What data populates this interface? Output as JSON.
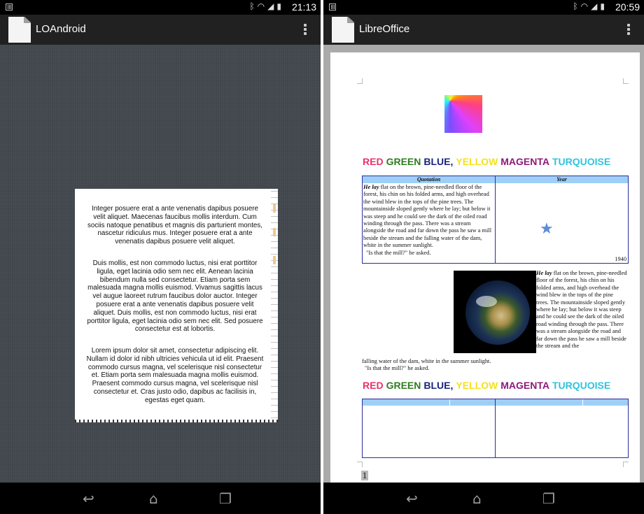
{
  "left_screen": {
    "status": {
      "time": "21:13"
    },
    "appbar": {
      "title": "LOAndroid"
    },
    "document": {
      "paragraphs": [
        "Integer posuere erat a ante venenatis dapibus posuere velit aliquet. Maecenas faucibus mollis interdum. Cum sociis natoque penatibus et magnis dis parturient montes, nascetur ridiculus mus. Integer posuere erat a ante venenatis dapibus posuere velit aliquet.",
        "Duis mollis, est non commodo luctus, nisi erat porttitor ligula, eget lacinia odio sem nec elit. Aenean lacinia bibendum nulla sed consectetur. Etiam porta sem malesuada magna mollis euismod. Vivamus sagittis lacus vel augue laoreet rutrum faucibus dolor auctor. Integer posuere erat a ante venenatis dapibus posuere velit aliquet. Duis mollis, est non commodo luctus, nisi erat porttitor ligula, eget lacinia odio sem nec elit. Sed posuere consectetur est at lobortis.",
        "Lorem ipsum dolor sit amet, consectetur adipiscing elit. Nullam id dolor id nibh ultricies vehicula ut id elit. Praesent commodo cursus magna, vel scelerisque nisl consectetur et. Etiam porta sem malesuada magna mollis euismod. Praesent commodo cursus magna, vel scelerisque nisl consectetur et. Cras justo odio, dapibus ac facilisis in, egestas eget quam."
      ]
    }
  },
  "right_screen": {
    "status": {
      "time": "20:59"
    },
    "appbar": {
      "title": "LibreOffice"
    },
    "document": {
      "color_words": [
        {
          "text": "RED",
          "color": "#e8336b"
        },
        {
          "text": "GREEN",
          "color": "#2e7d1f"
        },
        {
          "text": "BLUE,",
          "color": "#1a237e"
        },
        {
          "text": "YELLOW",
          "color": "#f4e21a"
        },
        {
          "text": "MAGENTA",
          "color": "#8e1a7a"
        },
        {
          "text": "TURQUOISE",
          "color": "#2ec3dd"
        }
      ],
      "table1": {
        "headers": [
          "Quotation",
          "Year"
        ],
        "quote_lead": "He lay",
        "quote_body": "flat on the brown, pine-needled floor of the forest, his chin on his folded arms, and high overhead the wind blew in the tops of the pine trees. The mountainside sloped gently where he lay; but below it was steep and he could see the dark of the oiled road winding through the pass. There was a stream alongside the road and far down the pass he saw a mill beside the stream and the falling water of the dam, white in the summer sunlight.",
        "quote_end": "\"Is that the mill?\" he asked.",
        "year": "1940"
      },
      "wrap_lead": "He lay",
      "wrap_body": "flat on the brown, pine-needled floor of the forest, his chin on his folded arms, and high overhead the wind blew in the tops of the pine trees. The mountainside sloped gently where he lay; but below it was steep and he could see the dark of the oiled road winding through the pass. There was a stream alongside the road and far down the pass he saw a mill beside the stream and the",
      "tail_line": "falling water of the dam, white in the summer sunlight.",
      "tail_quote": "\"Is that the mill?\" he asked.",
      "page_number": "1"
    }
  },
  "colors": {
    "appbar": "#212121",
    "left_canvas": "#40464b",
    "right_canvas": "#aaaaaa",
    "table_border": "#2a2e99",
    "table_header": "#9fcff7",
    "star": "#5b8ed6"
  },
  "icons": {
    "status": [
      "notification-icon",
      "bluetooth-icon",
      "wifi-icon",
      "signal-icon",
      "battery-icon"
    ],
    "appbar": [
      "document-icon",
      "overflow-menu-icon"
    ],
    "nav": [
      "back-icon",
      "home-icon",
      "recent-apps-icon"
    ]
  }
}
